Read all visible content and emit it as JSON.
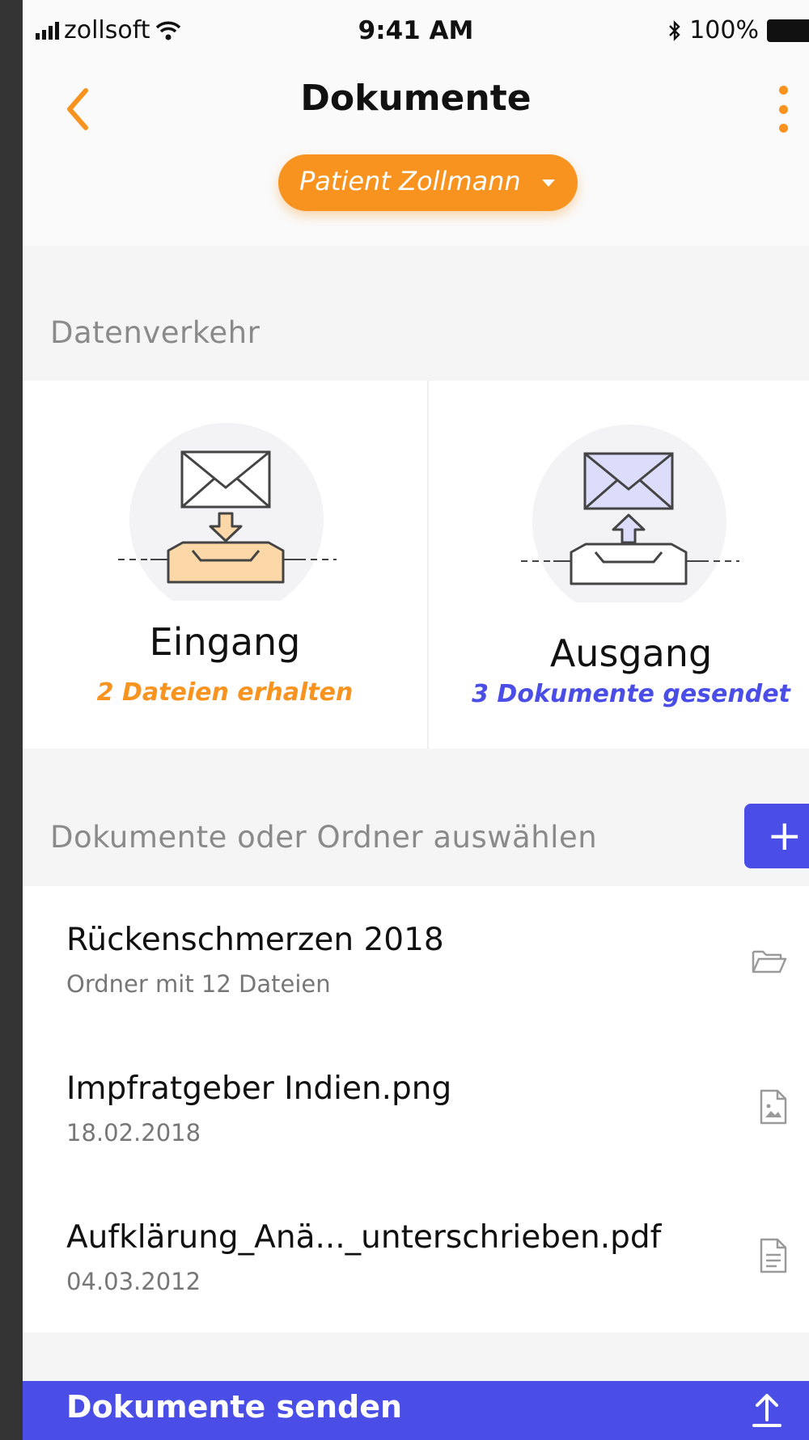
{
  "status_bar": {
    "carrier": "zollsoft",
    "time": "9:41 AM",
    "battery": "100%"
  },
  "header": {
    "title": "Dokumente",
    "patient_selector": "Patient Zollmann"
  },
  "traffic_section": {
    "label": "Datenverkehr",
    "inbox": {
      "title": "Eingang",
      "subtitle": "2 Dateien erhalten",
      "subtitle_color": "#f7931e"
    },
    "outbox": {
      "title": "Ausgang",
      "subtitle": "3 Dokumente gesendet",
      "subtitle_color": "#4a4ee6"
    }
  },
  "documents_section": {
    "label": "Dokumente oder Ordner auswählen",
    "add_label": "+",
    "items": [
      {
        "name": "Rückenschmerzen 2018",
        "detail": "Ordner mit 12 Dateien",
        "icon": "folder-icon"
      },
      {
        "name": "Impfratgeber Indien.png",
        "detail": "18.02.2018",
        "icon": "image-file-icon"
      },
      {
        "name": "Aufklärung_Anä..._unterschrieben.pdf",
        "detail": "04.03.2012",
        "icon": "document-file-icon"
      }
    ]
  },
  "footer": {
    "send_label": "Dokumente senden"
  },
  "colors": {
    "accent_orange": "#f7931e",
    "accent_blue": "#4a4ee6"
  }
}
